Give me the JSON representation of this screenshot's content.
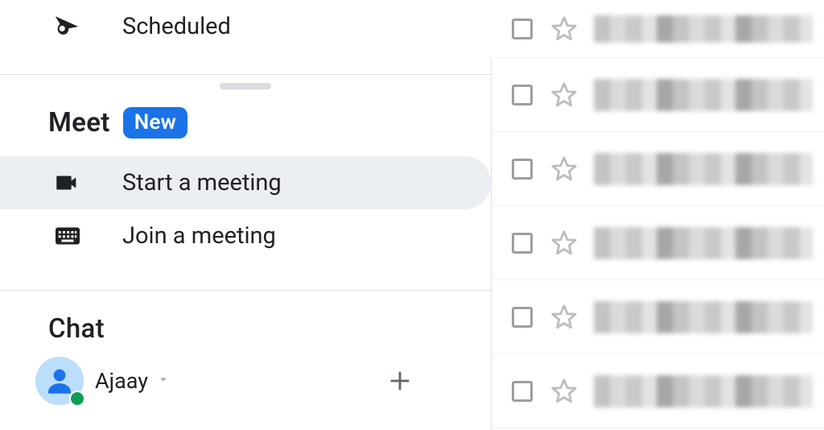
{
  "sidebar": {
    "scheduled_label": "Scheduled",
    "meet": {
      "title": "Meet",
      "badge": "New",
      "start_label": "Start a meeting",
      "join_label": "Join a meeting"
    },
    "chat": {
      "title": "Chat",
      "user_name": "Ajaay"
    }
  }
}
